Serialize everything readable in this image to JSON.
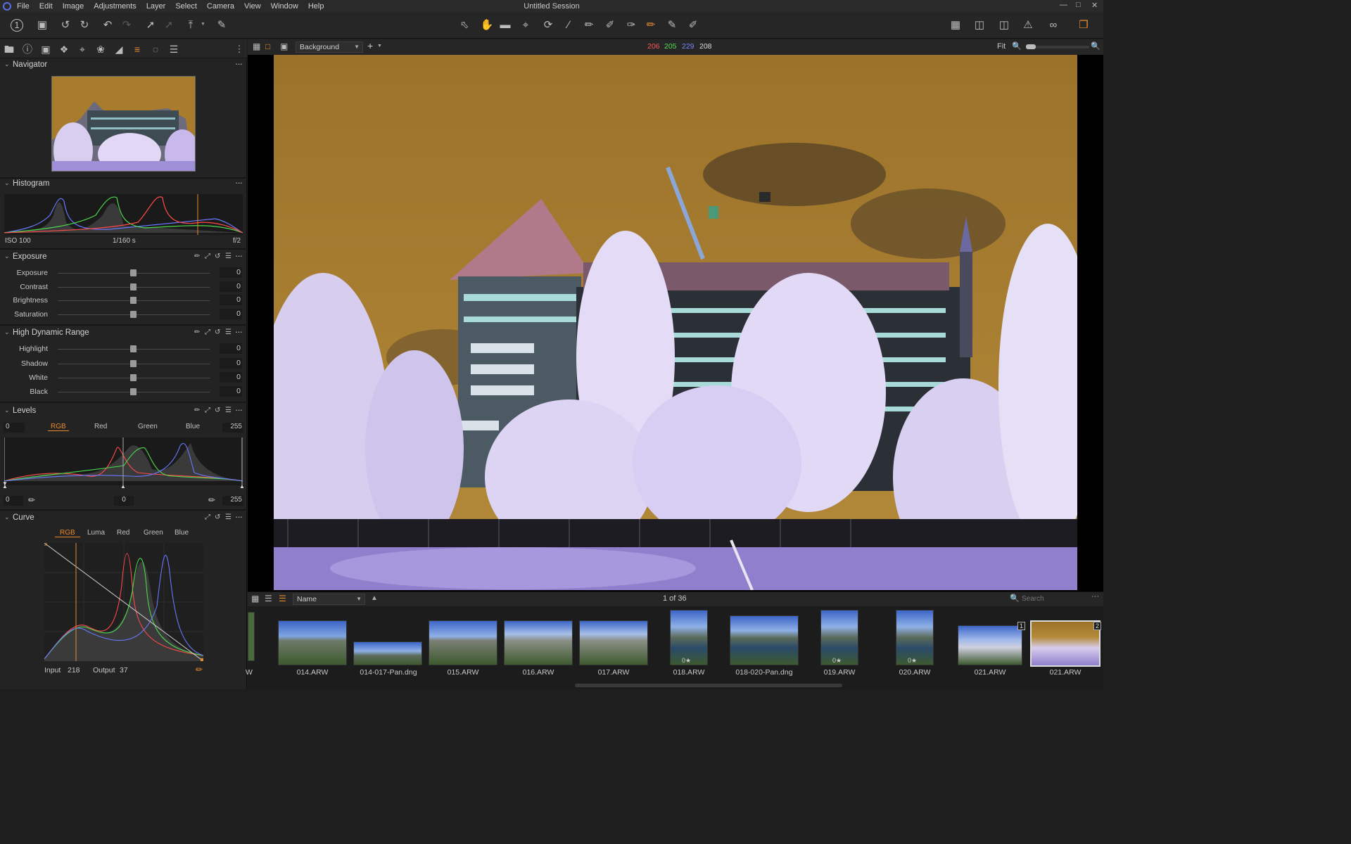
{
  "app": {
    "title": "Untitled Session",
    "menu": [
      "File",
      "Edit",
      "Image",
      "Adjustments",
      "Layer",
      "Select",
      "Camera",
      "View",
      "Window",
      "Help"
    ]
  },
  "toolbar_icons": [
    "capture-one-icon",
    "camera-icon",
    "rotate-left-icon",
    "rotate-right-icon",
    "undo-icon",
    "redo-icon",
    "process-icon",
    "process-dim-icon",
    "export-icon",
    "brush-icon",
    "cursor-tool-icon",
    "hand-tool-icon",
    "crop-mask-tool-icon",
    "crop-tool-icon",
    "rotate-tool-icon",
    "straighten-tool-icon",
    "picker-tool-icon",
    "heal-tool-icon",
    "erase-tool-icon",
    "brush-tool-icon",
    "gradient-tool-icon",
    "eraser-tool-icon",
    "grid-icon",
    "guides-icon",
    "compare-icon",
    "warning-icon",
    "glasses-icon",
    "workspace-icon"
  ],
  "viewer": {
    "layer": "Background",
    "rgb": {
      "r": "206",
      "g": "205",
      "b": "229",
      "l": "208"
    },
    "fit_label": "Fit"
  },
  "navigator": {
    "title": "Navigator"
  },
  "histogram": {
    "title": "Histogram",
    "iso": "ISO 100",
    "shutter": "1/160 s",
    "aperture": "f/2"
  },
  "exposure": {
    "title": "Exposure",
    "rows": [
      {
        "label": "Exposure",
        "value": "0"
      },
      {
        "label": "Contrast",
        "value": "0"
      },
      {
        "label": "Brightness",
        "value": "0"
      },
      {
        "label": "Saturation",
        "value": "0"
      }
    ]
  },
  "hdr": {
    "title": "High Dynamic Range",
    "rows": [
      {
        "label": "Highlight",
        "value": "0"
      },
      {
        "label": "Shadow",
        "value": "0"
      },
      {
        "label": "White",
        "value": "0"
      },
      {
        "label": "Black",
        "value": "0"
      }
    ]
  },
  "levels": {
    "title": "Levels",
    "tabs": [
      "RGB",
      "Red",
      "Green",
      "Blue"
    ],
    "in_low": "0",
    "in_high": "255",
    "out_low": "0",
    "mid": "0",
    "out_high": "255"
  },
  "curve": {
    "title": "Curve",
    "tabs": [
      "RGB",
      "Luma",
      "Red",
      "Green",
      "Blue"
    ],
    "input_label": "Input",
    "input_value": "218",
    "output_label": "Output",
    "output_value": "37"
  },
  "browser": {
    "sort": "Name",
    "count": "1 of 36",
    "search_placeholder": "Search",
    "thumbs": [
      {
        "name": "W"
      },
      {
        "name": "014.ARW"
      },
      {
        "name": "014-017-Pan.dng"
      },
      {
        "name": "015.ARW"
      },
      {
        "name": "016.ARW"
      },
      {
        "name": "017.ARW"
      },
      {
        "name": "018.ARW",
        "stars": "0★"
      },
      {
        "name": "018-020-Pan.dng"
      },
      {
        "name": "019.ARW",
        "stars": "0★"
      },
      {
        "name": "020.ARW",
        "stars": "0★"
      },
      {
        "name": "021.ARW",
        "badge": "1"
      },
      {
        "name": "021.ARW",
        "badge": "2"
      }
    ]
  },
  "colors": {
    "accent": "#e88a2c",
    "sky": "#a87c2c"
  }
}
